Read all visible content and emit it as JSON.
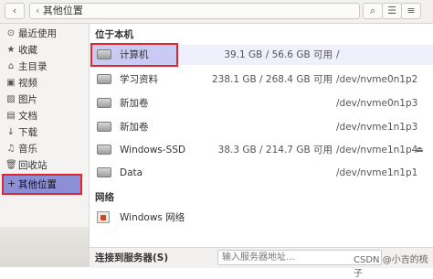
{
  "header": {
    "back_icon": "‹",
    "more_icon": "⋯",
    "path_label": "其他位置"
  },
  "sidebar": {
    "items": [
      {
        "icon": "⊙",
        "label": "最近使用"
      },
      {
        "icon": "★",
        "label": "收藏"
      },
      {
        "icon": "⌂",
        "label": "主目录"
      },
      {
        "icon": "▣",
        "label": "视频"
      },
      {
        "icon": "▨",
        "label": "图片"
      },
      {
        "icon": "▤",
        "label": "文档"
      },
      {
        "icon": "↓",
        "label": "下载"
      },
      {
        "icon": "♫",
        "label": "音乐"
      },
      {
        "icon": "🗑",
        "label": "回收站"
      }
    ],
    "selected": {
      "icon": "+",
      "label": "其他位置"
    }
  },
  "main": {
    "section_local": "位于本机",
    "drives": [
      {
        "name": "计算机",
        "size": "39.1 GB / 56.6 GB 可用",
        "dev": "/",
        "eject": false
      },
      {
        "name": "学习资料",
        "size": "238.1 GB / 268.4 GB 可用",
        "dev": "/dev/nvme0n1p2",
        "eject": false
      },
      {
        "name": "新加卷",
        "size": "",
        "dev": "/dev/nvme0n1p3",
        "eject": false
      },
      {
        "name": "新加卷",
        "size": "",
        "dev": "/dev/nvme1n1p3",
        "eject": false
      },
      {
        "name": "Windows-SSD",
        "size": "38.3 GB / 214.7 GB 可用",
        "dev": "/dev/nvme1n1p4",
        "eject": true
      },
      {
        "name": "Data",
        "size": "",
        "dev": "/dev/nvme1n1p1",
        "eject": false
      }
    ],
    "section_network": "网络",
    "network": [
      {
        "name": "Windows 网络"
      }
    ]
  },
  "bottom": {
    "connect_label": "连接到服务器(S)",
    "server_placeholder": "输入服务器地址...",
    "watermark": "CSDN @小吉的梳子"
  }
}
